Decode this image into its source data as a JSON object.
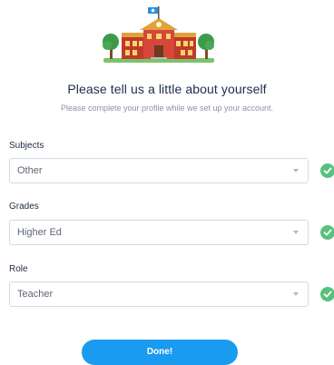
{
  "header": {
    "illustration": "school-building-icon",
    "title": "Please tell us a little about yourself",
    "subtitle": "Please complete your profile while we set up your account."
  },
  "fields": [
    {
      "label": "Subjects",
      "value": "Other",
      "valid": true
    },
    {
      "label": "Grades",
      "value": "Higher Ed",
      "valid": true
    },
    {
      "label": "Role",
      "value": "Teacher",
      "valid": true
    }
  ],
  "done_label": "Done!",
  "colors": {
    "accent": "#1a9bf0",
    "success": "#58c17d",
    "title": "#1e2b4d"
  }
}
